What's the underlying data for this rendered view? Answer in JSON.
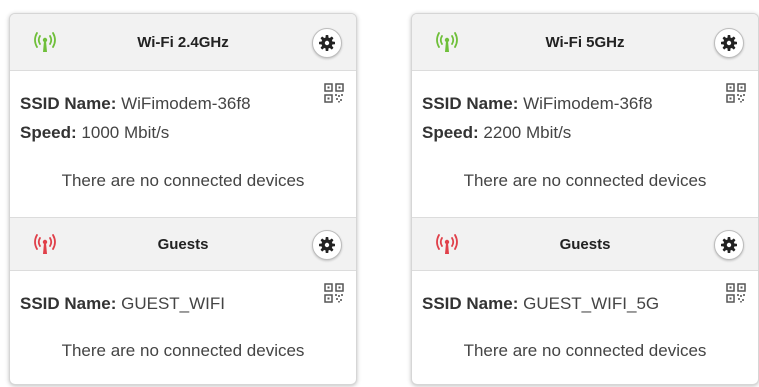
{
  "cards": [
    {
      "primary": {
        "title": "Wi-Fi 2.4GHz",
        "ssid_label": "SSID Name:",
        "ssid_value": "WiFimodem-36f8",
        "speed_label": "Speed:",
        "speed_value": "1000 Mbit/s",
        "devices_text": "There are no connected devices"
      },
      "guest": {
        "title": "Guests",
        "ssid_label": "SSID Name:",
        "ssid_value": "GUEST_WIFI",
        "devices_text": "There are no connected devices"
      }
    },
    {
      "primary": {
        "title": "Wi-Fi 5GHz",
        "ssid_label": "SSID Name:",
        "ssid_value": "WiFimodem-36f8",
        "speed_label": "Speed:",
        "speed_value": "2200 Mbit/s",
        "devices_text": "There are no connected devices"
      },
      "guest": {
        "title": "Guests",
        "ssid_label": "SSID Name:",
        "ssid_value": "GUEST_WIFI_5G",
        "devices_text": "There are no connected devices"
      }
    }
  ],
  "icons": {
    "primary_antenna": "wifi-antenna-icon",
    "guest_antenna": "guest-antenna-icon",
    "settings": "gear-icon",
    "qr": "qr-code-icon"
  },
  "colors": {
    "antenna_active": "#6fbf3a",
    "antenna_guest": "#e0404a",
    "header_bg": "#f2f2f2"
  }
}
